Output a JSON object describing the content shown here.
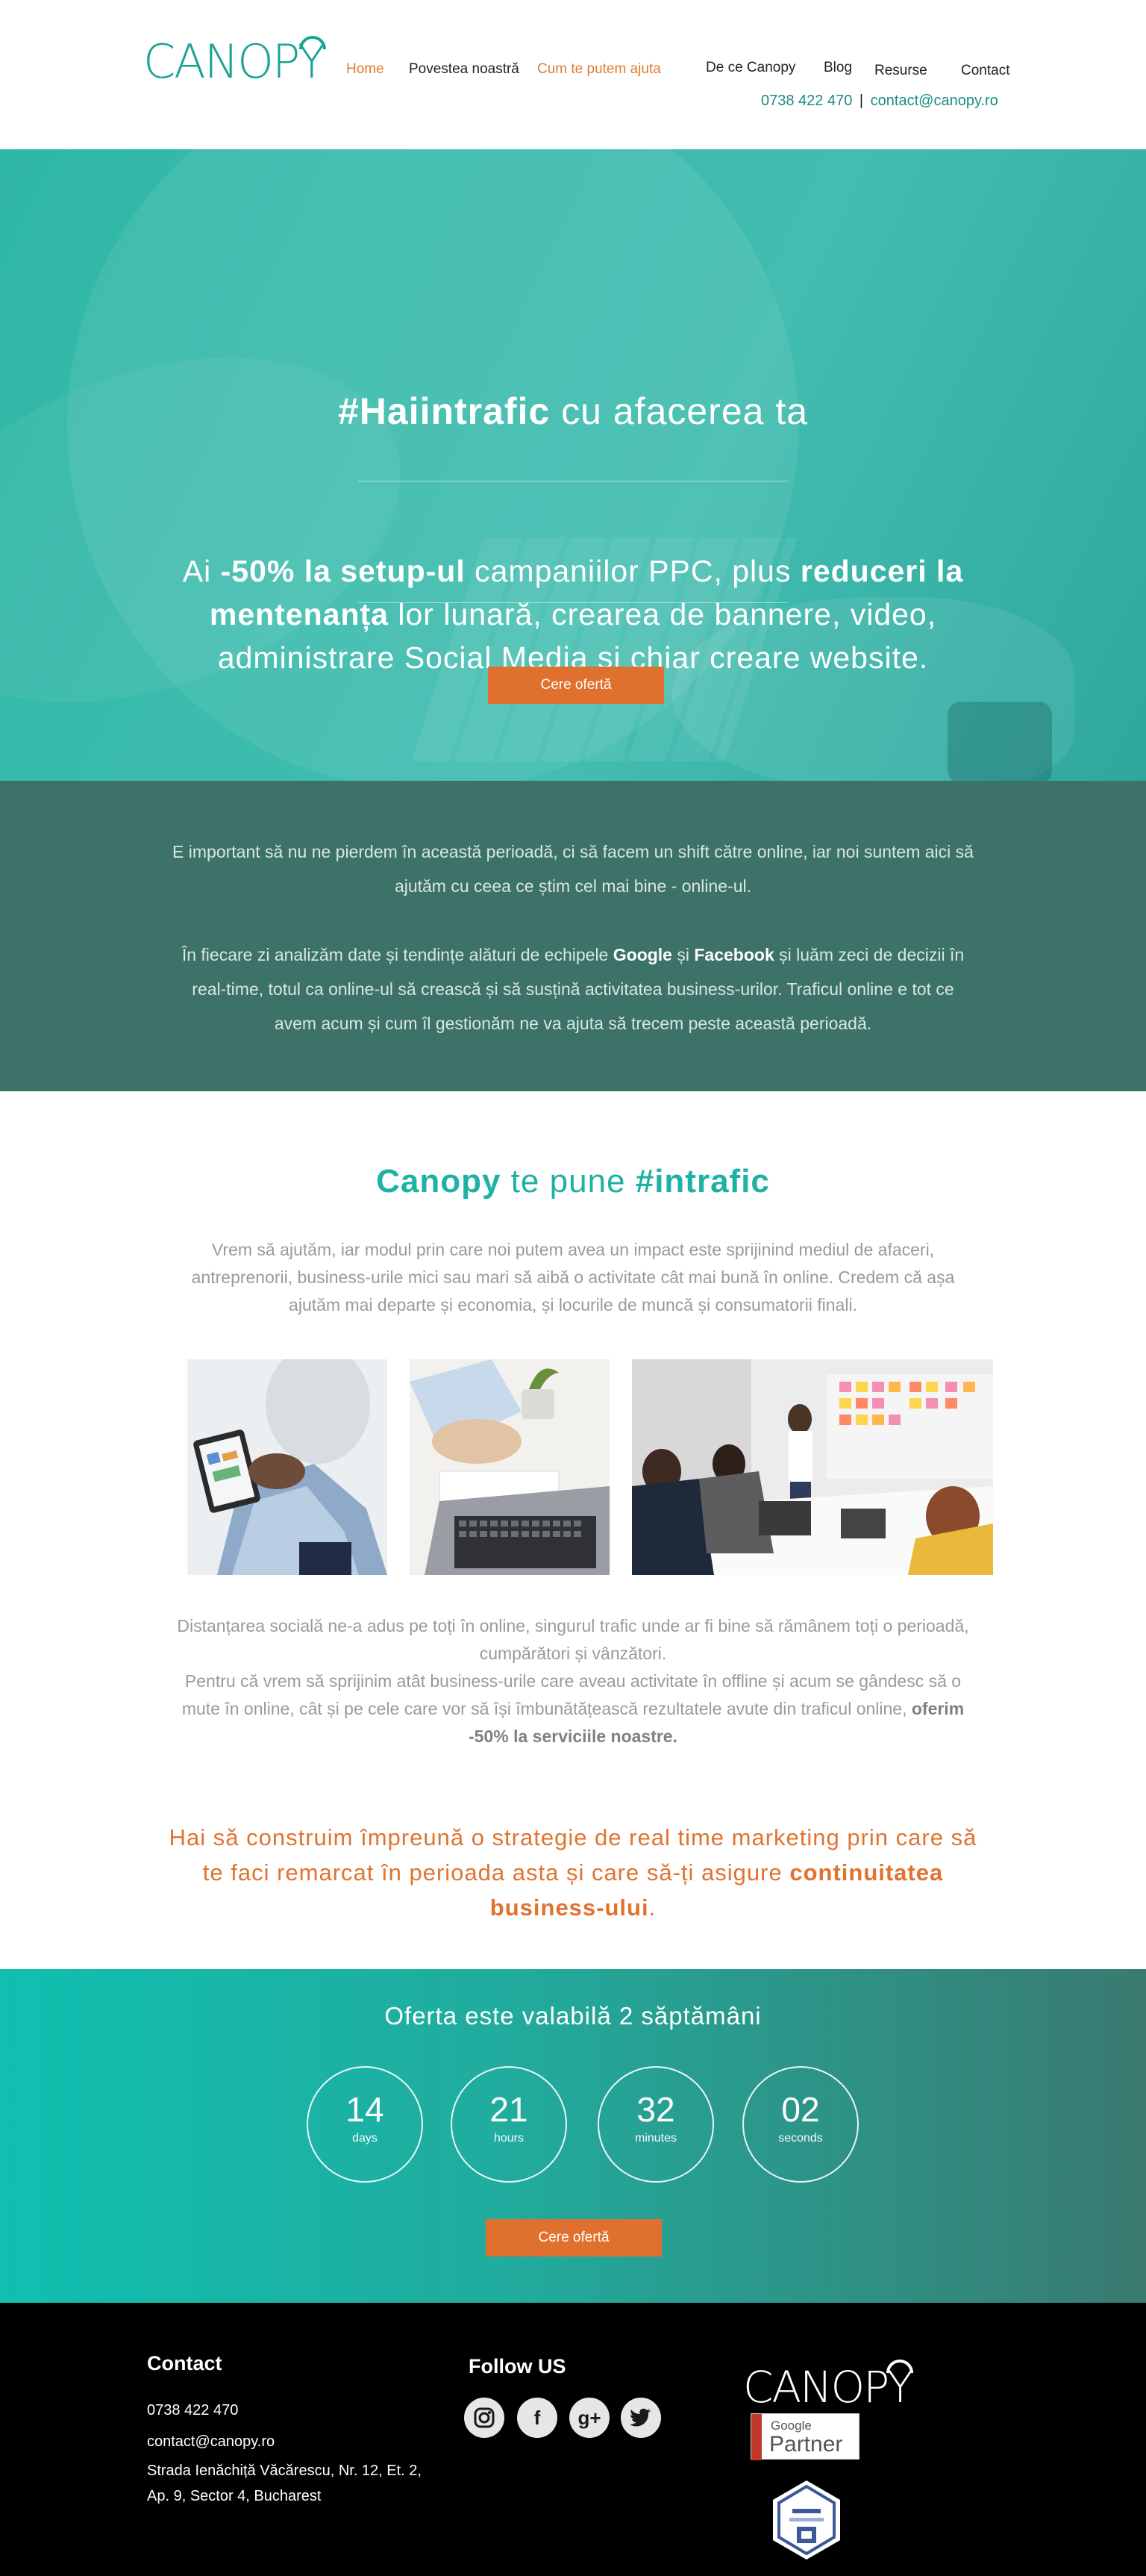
{
  "header": {
    "logo_text": "CANOPY",
    "nav": [
      {
        "label": "Home",
        "active": true
      },
      {
        "label": "Povestea noastră",
        "active": false
      },
      {
        "label": "Cum te putem ajuta",
        "active": false
      },
      {
        "label": "De ce Canopy",
        "active": false
      },
      {
        "label": "Blog",
        "active": false
      },
      {
        "label": "Resurse",
        "active": false
      },
      {
        "label": "Contact",
        "active": false
      }
    ],
    "phone": "0738 422 470",
    "separator": "|",
    "email": "contact@canopy.ro"
  },
  "hero": {
    "title_bold": "#Haiintrafic",
    "title_rest": " cu afacerea ta",
    "sub_1": "Ai ",
    "sub_2": "-50% la setup-ul",
    "sub_3": " campaniilor PPC, plus ",
    "sub_4": "reduceri la mentenanța",
    "sub_5": " lor lunară, crearea de bannere, video, administrare Social Media și chiar creare website.",
    "cta": "Cere ofertă"
  },
  "intro": {
    "p1": "E important să nu ne pierdem în această perioadă, ci să facem un shift către online, iar noi suntem aici să ajutăm cu ceea ce știm cel mai bine - online-ul.",
    "p2_a": "În fiecare zi analizăm date și tendințe alături de echipele ",
    "p2_b": "Google",
    "p2_c": " și ",
    "p2_d": "Facebook",
    "p2_e": " și luăm zeci de decizii în real-time, totul ca online-ul să crească și să susțină activitatea business-urilor. Traficul online e tot ce avem acum și cum îl gestionăm ne va ajuta să trecem peste această perioadă."
  },
  "content": {
    "title_bold1": "Canopy",
    "title_mid": " te pune ",
    "title_bold2": "#intrafic",
    "p1": "Vrem să ajutăm, iar modul prin care noi putem avea un impact este sprijinind mediul de afaceri, antreprenorii, business-urile mici sau mari să aibă o activitate cât mai bună în online. Credem că așa ajutăm mai departe și economia, și locurile de muncă și consumatorii finali.",
    "p2": "Distanțarea socială ne-a adus pe toți în online, singurul trafic unde ar fi bine să rămânem toți o perioadă, cumpărători și vânzători.",
    "p3_a": "Pentru că vrem să sprijinim atât business-urile care aveau activitate în offline și acum se gândesc să o mute în online, cât și pe cele care vor să își îmbunătățească rezultatele avute din traficul online, ",
    "p3_b": "oferim -50% la serviciile noastre.",
    "orange_a": "Hai să construim împreună o strategie de real time marketing prin care să te faci remarcat în perioada asta și care să-ți asigure ",
    "orange_b": "continuitatea business-ului",
    "orange_c": "."
  },
  "countdown": {
    "title": "Oferta este valabilă 2 săptămâni",
    "items": [
      {
        "num": "14",
        "unit": "days"
      },
      {
        "num": "21",
        "unit": "hours"
      },
      {
        "num": "32",
        "unit": "minutes"
      },
      {
        "num": "02",
        "unit": "seconds"
      }
    ],
    "cta": "Cere ofertă"
  },
  "footer": {
    "contact_title": "Contact",
    "phone": "0738 422 470",
    "email": "contact@canopy.ro",
    "address": "Strada Ienăchiță Văcărescu, Nr. 12, Et. 2, Ap. 9, Sector 4, Bucharest",
    "follow_title": "Follow US",
    "social": [
      {
        "icon": "instagram-icon",
        "glyph": "◎"
      },
      {
        "icon": "facebook-icon",
        "glyph": "f"
      },
      {
        "icon": "google-plus-icon",
        "glyph": "g+"
      },
      {
        "icon": "twitter-icon",
        "glyph": "🐦"
      }
    ],
    "logo_text": "CANOPY",
    "gp_google": "Google",
    "gp_partner": "Partner"
  },
  "colors": {
    "brand_teal": "#1aa393",
    "accent_orange": "#e0702e",
    "dark_teal": "#3c7268"
  }
}
